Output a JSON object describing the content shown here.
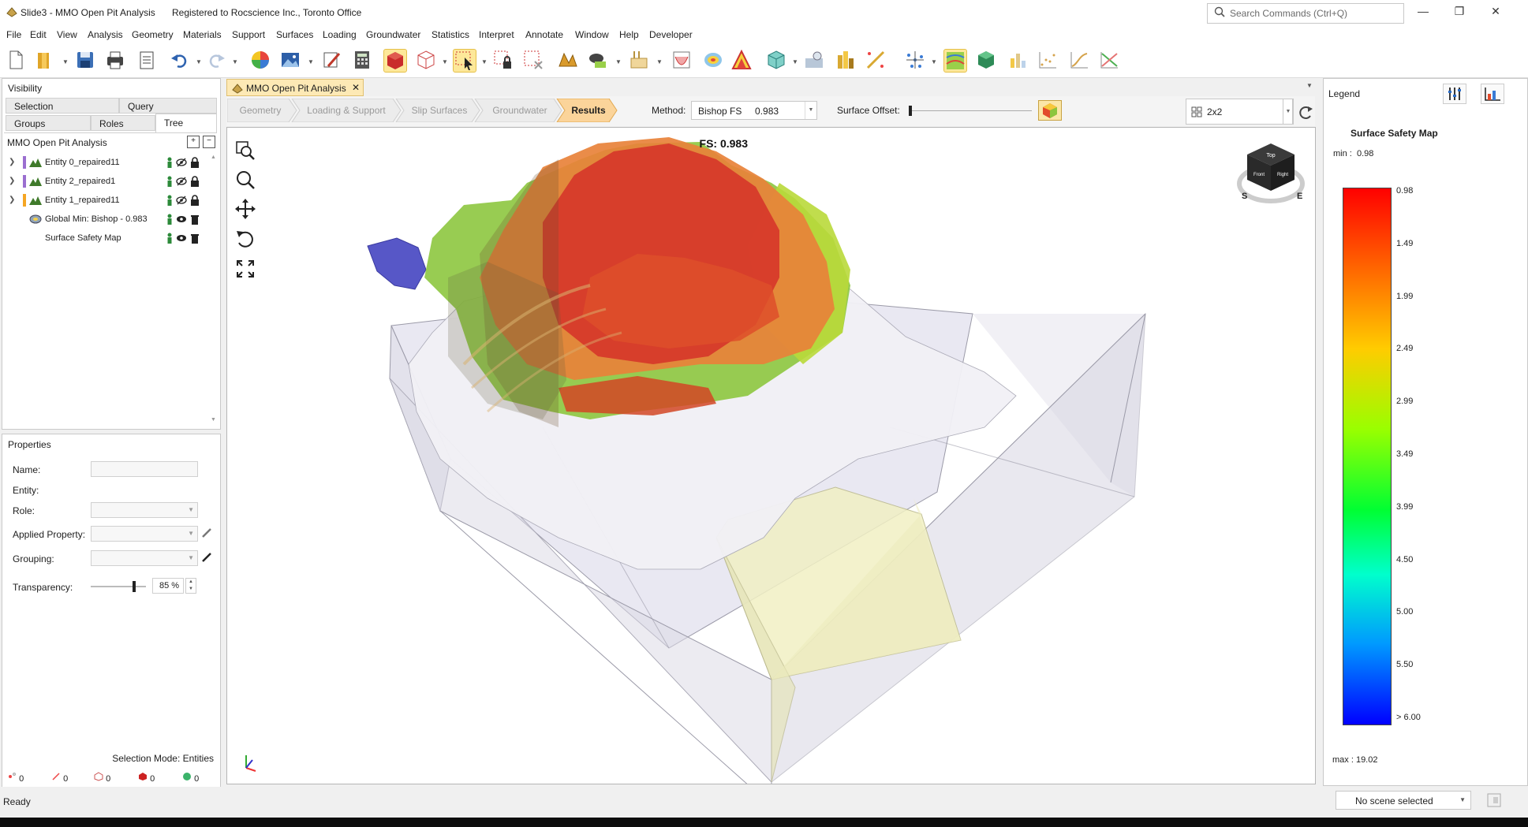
{
  "window": {
    "app_title": "Slide3 - MMO Open Pit Analysis",
    "registration": "Registered to Rocscience Inc., Toronto Office",
    "search_placeholder": "Search Commands (Ctrl+Q)"
  },
  "menu": [
    "File",
    "Edit",
    "View",
    "Analysis",
    "Geometry",
    "Materials",
    "Support",
    "Surfaces",
    "Loading",
    "Groundwater",
    "Statistics",
    "Interpret",
    "Annotate",
    "Window",
    "Help",
    "Developer"
  ],
  "visibility": {
    "title": "Visibility",
    "tabs_top": [
      "Selection",
      "Query"
    ],
    "tabs_bottom": [
      "Groups",
      "Roles",
      "Tree"
    ],
    "active_tab": "Tree",
    "tree_root": "MMO Open Pit Analysis",
    "items": [
      {
        "label": "Entity 0_repaired11",
        "color": "#9b6fd0"
      },
      {
        "label": "Entity 2_repaired1",
        "color": "#9b6fd0"
      },
      {
        "label": "Entity 1_repaired11",
        "color": "#9b6fd0"
      },
      {
        "label": "Global Min: Bishop  -  0.983",
        "color": "#e0287a"
      },
      {
        "label": "Surface Safety Map",
        "color": "#f5a623"
      }
    ]
  },
  "properties": {
    "title": "Properties",
    "fields": [
      "Name:",
      "Entity:",
      "Role:",
      "Applied Property:",
      "Grouping:",
      "Transparency:"
    ],
    "transparency_value": "85 %",
    "transparency_level": 0.85,
    "selection_mode": "Selection Mode: Entities",
    "counters": [
      "0",
      "0",
      "0",
      "0",
      "0"
    ]
  },
  "document_tab": "MMO Open Pit Analysis",
  "workflow": {
    "steps": [
      "Geometry",
      "Loading & Support",
      "Slip Surfaces",
      "Groundwater",
      "Results"
    ],
    "active": "Results",
    "method_label": "Method:",
    "method_value": "Bishop FS     0.983",
    "surface_offset_label": "Surface Offset:",
    "layout_value": "2x2"
  },
  "viewport": {
    "fs_label": "FS: 0.983",
    "cube_faces": [
      "Top",
      "Front",
      "Right"
    ],
    "compass": [
      "S",
      "E"
    ]
  },
  "legend": {
    "title": "Legend",
    "map_title": "Surface Safety Map",
    "min_text": "min :  0.98",
    "max_text": "max : 19.02",
    "ticks": [
      "0.98",
      "1.49",
      "1.99",
      "2.49",
      "2.99",
      "3.49",
      "3.99",
      "4.50",
      "5.00",
      "5.50",
      "> 6.00"
    ]
  },
  "statusbar": {
    "status": "Ready",
    "scene": "No scene selected"
  }
}
